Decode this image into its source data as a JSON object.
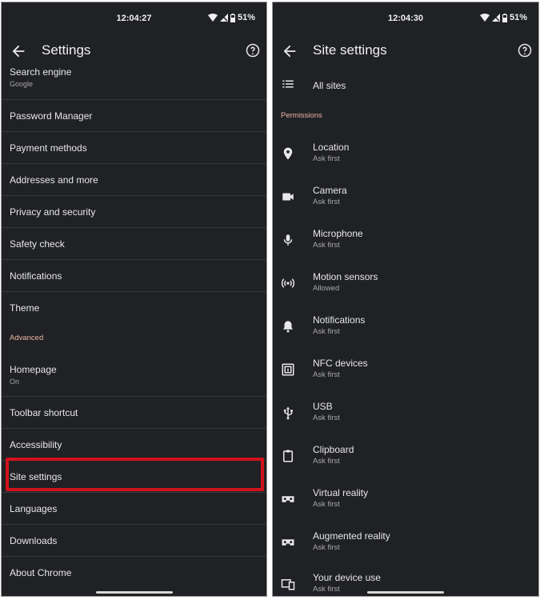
{
  "left": {
    "status": {
      "time": "12:04:27",
      "battery": "51%"
    },
    "title": "Settings",
    "rows": [
      {
        "label": "Search engine",
        "sub": "Google"
      },
      {
        "label": "Password Manager"
      },
      {
        "label": "Payment methods"
      },
      {
        "label": "Addresses and more"
      },
      {
        "label": "Privacy and security"
      },
      {
        "label": "Safety check"
      },
      {
        "label": "Notifications"
      },
      {
        "label": "Theme"
      }
    ],
    "section_advanced": "Advanced",
    "rows2": [
      {
        "label": "Homepage",
        "sub": "On"
      },
      {
        "label": "Toolbar shortcut"
      },
      {
        "label": "Accessibility"
      },
      {
        "label": "Site settings"
      },
      {
        "label": "Languages"
      },
      {
        "label": "Downloads"
      },
      {
        "label": "About Chrome"
      }
    ]
  },
  "right": {
    "status": {
      "time": "12:04:30",
      "battery": "51%"
    },
    "title": "Site settings",
    "all_sites": "All sites",
    "section_permissions": "Permissions",
    "items": [
      {
        "label": "Location",
        "sub": "Ask first",
        "icon": "location-pin-icon"
      },
      {
        "label": "Camera",
        "sub": "Ask first",
        "icon": "camera-icon"
      },
      {
        "label": "Microphone",
        "sub": "Ask first",
        "icon": "microphone-icon"
      },
      {
        "label": "Motion sensors",
        "sub": "Allowed",
        "icon": "motion-sensor-icon"
      },
      {
        "label": "Notifications",
        "sub": "Ask first",
        "icon": "bell-icon"
      },
      {
        "label": "NFC devices",
        "sub": "Ask first",
        "icon": "nfc-icon"
      },
      {
        "label": "USB",
        "sub": "Ask first",
        "icon": "usb-icon"
      },
      {
        "label": "Clipboard",
        "sub": "Ask first",
        "icon": "clipboard-icon"
      },
      {
        "label": "Virtual reality",
        "sub": "Ask first",
        "icon": "vr-headset-icon"
      },
      {
        "label": "Augmented reality",
        "sub": "Ask first",
        "icon": "ar-headset-icon"
      },
      {
        "label": "Your device use",
        "sub": "Ask first",
        "icon": "device-use-icon"
      }
    ]
  },
  "colors": {
    "background": "#202124",
    "divider": "#3a3b3e",
    "section": "#e6b6a2",
    "highlight": "#d2121c"
  }
}
